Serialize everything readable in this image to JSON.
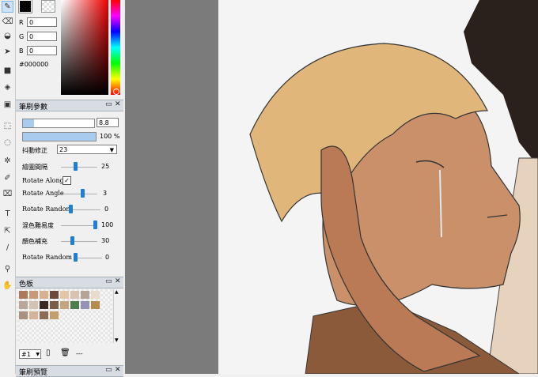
{
  "color": {
    "r_label": "R",
    "r_value": "0",
    "g_label": "G",
    "g_value": "0",
    "b_label": "B",
    "b_value": "0",
    "hex": "#000000"
  },
  "brush_panel": {
    "title": "筆刷參數",
    "size_value": "8.8",
    "opacity_value": "100 %",
    "correction_label": "抖動修正",
    "correction_value": "23",
    "rows": [
      {
        "label": "繪圖間隔",
        "value": "25",
        "level": 0.4
      },
      {
        "label": "Rotate Along",
        "checked": true
      },
      {
        "label": "Rotate Angle",
        "value": "3",
        "level": 0.6
      },
      {
        "label": "Rotate Random",
        "value": "0",
        "level": 0.0
      },
      {
        "label": "混色難易度",
        "value": "100",
        "level": 1.0
      },
      {
        "label": "顏色補充",
        "value": "30",
        "level": 0.3
      },
      {
        "label": "Rotate Random 2",
        "value": "0",
        "level": 0.0
      }
    ]
  },
  "palette_panel": {
    "title": "色板",
    "preset": "#1",
    "dots": "---",
    "swatches": [
      "#a97a5c",
      "#c69a77",
      "#d7b08f",
      "#6b4a3a",
      "#e2c6a5",
      "#d8c3b3",
      "#b6a596",
      "#e8dccf",
      "#b9a79b",
      "#d2c3b5",
      "#3b2a23",
      "#7b5d48",
      "#c7a480",
      "#4d7f4b",
      "#9791b5",
      "#b58a4d",
      "#a99181",
      "#d3b499",
      "#8b6d56",
      "#c49e6c"
    ]
  },
  "bottom_panel": {
    "title": "筆刷預覽"
  },
  "colors": {
    "accent": "#1e7fd6",
    "panel_title_bg": "#d8dde3",
    "canvas_gray": "#7b7b7b"
  }
}
